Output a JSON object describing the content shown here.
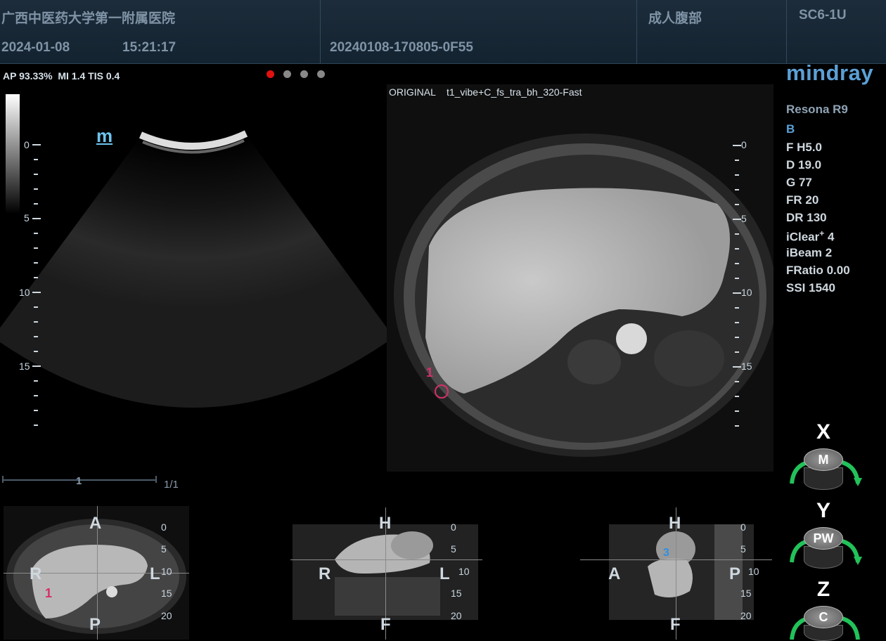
{
  "header": {
    "hospital": "广西中医药大学第一附属医院",
    "date": "2024-01-08",
    "time": "15:21:17",
    "exam_id": "20240108-170805-0F55",
    "exam_type": "成人腹部",
    "probe": "SC6-1U"
  },
  "status": {
    "acoustic": "AP 93.33%",
    "mi": "MI 1.4",
    "tis": "TIS 0.4"
  },
  "left_ruler": {
    "labels": [
      "0",
      "5",
      "10",
      "15"
    ]
  },
  "logo_mark": "m",
  "page_indicator": "1/1",
  "slider_marker": "1",
  "mri": {
    "caption": "ORIGINAL    t1_vibe+C_fs_tra_bh_320-Fast",
    "ruler_labels": [
      "0",
      "5",
      "10",
      "15"
    ],
    "marker": "1"
  },
  "brand": "mindray",
  "params": {
    "model": "Resona R9",
    "mode": "B",
    "freq": "F H5.0",
    "depth": "D 19.0",
    "gain": "G 77",
    "framerate": "FR 20",
    "dynrange": "DR 130",
    "iclear": "iClear",
    "iclear_sup": "+",
    "iclear_val": "4",
    "ibeam": "iBeam 2",
    "fratio": "FRatio 0.00",
    "ssi": "SSI 1540"
  },
  "axis_controls": [
    {
      "letter": "X",
      "knob": "M"
    },
    {
      "letter": "Y",
      "knob": "PW"
    },
    {
      "letter": "Z",
      "knob": "C"
    }
  ],
  "ortho_views": {
    "axial": {
      "top": "A",
      "bottom": "P",
      "left": "R",
      "right": "L",
      "marker": "1",
      "ruler": [
        "0",
        "5",
        "10",
        "15",
        "20"
      ]
    },
    "coronal": {
      "top": "H",
      "bottom": "F",
      "left": "R",
      "right": "L",
      "ruler": [
        "0",
        "5",
        "10",
        "15",
        "20"
      ]
    },
    "sagittal": {
      "top": "H",
      "bottom": "F",
      "left": "A",
      "right": "P",
      "marker": "3",
      "ruler": [
        "0",
        "5",
        "10",
        "15",
        "20"
      ]
    }
  },
  "colors": {
    "accent_brand": "#5ba0d6",
    "active_dot": "#e0120f",
    "marker_pink": "#d4306a",
    "marker_blue": "#2f8fe0",
    "knob_arrow": "#22c25a"
  }
}
